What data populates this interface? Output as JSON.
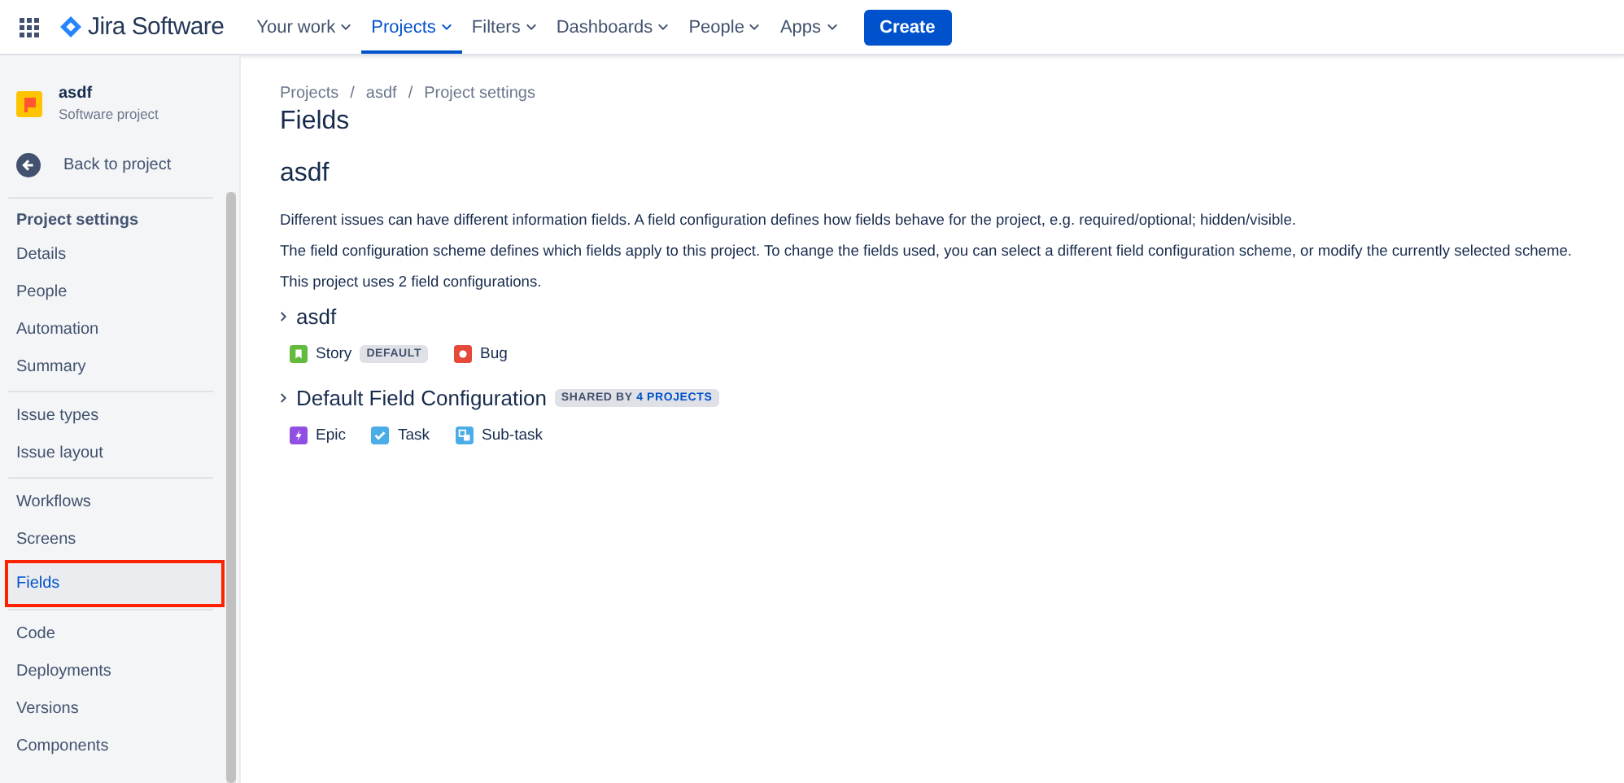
{
  "topbar": {
    "product": "Jira Software",
    "nav": [
      {
        "label": "Your work",
        "selected": false
      },
      {
        "label": "Projects",
        "selected": true
      },
      {
        "label": "Filters",
        "selected": false
      },
      {
        "label": "Dashboards",
        "selected": false
      },
      {
        "label": "People",
        "selected": false
      },
      {
        "label": "Apps",
        "selected": false
      }
    ],
    "create": "Create"
  },
  "sidebar": {
    "project": {
      "name": "asdf",
      "type": "Software project"
    },
    "back": "Back to project",
    "heading": "Project settings",
    "groups": [
      [
        {
          "label": "Details",
          "selected": false,
          "highlighted": false
        },
        {
          "label": "People",
          "selected": false,
          "highlighted": false
        },
        {
          "label": "Automation",
          "selected": false,
          "highlighted": false
        },
        {
          "label": "Summary",
          "selected": false,
          "highlighted": false
        }
      ],
      [
        {
          "label": "Issue types",
          "selected": false,
          "highlighted": false
        },
        {
          "label": "Issue layout",
          "selected": false,
          "highlighted": false
        }
      ],
      [
        {
          "label": "Workflows",
          "selected": false,
          "highlighted": false
        },
        {
          "label": "Screens",
          "selected": false,
          "highlighted": false
        },
        {
          "label": "Fields",
          "selected": true,
          "highlighted": true
        }
      ],
      [
        {
          "label": "Code",
          "selected": false,
          "highlighted": false
        },
        {
          "label": "Deployments",
          "selected": false,
          "highlighted": false
        },
        {
          "label": "Versions",
          "selected": false,
          "highlighted": false
        },
        {
          "label": "Components",
          "selected": false,
          "highlighted": false
        }
      ]
    ]
  },
  "breadcrumbs": [
    "Projects",
    "asdf",
    "Project settings"
  ],
  "breadcrumb_separator": "/",
  "title": "Fields",
  "subtitle": "asdf",
  "paragraphs": [
    "Different issues can have different information fields. A field configuration defines how fields behave for the project, e.g. required/optional; hidden/visible.",
    "The field configuration scheme defines which fields apply to this project. To change the fields used, you can select a different field configuration scheme, or modify the currently selected scheme.",
    "This project uses 2 field configurations."
  ],
  "configurations": [
    {
      "name": "asdf",
      "expanded": false,
      "issue_types": [
        {
          "name": "Story",
          "kind": "story",
          "color": "#63ba3c",
          "lozenge": "DEFAULT"
        },
        {
          "name": "Bug",
          "kind": "bug",
          "color": "#e5493a"
        }
      ]
    },
    {
      "name": "Default Field Configuration",
      "expanded": false,
      "shared": "**SHARED BY** 4 PROJECTS",
      "issue_types": [
        {
          "name": "Epic",
          "kind": "epic",
          "color": "#904ee2"
        },
        {
          "name": "Task",
          "kind": "task",
          "color": "#4bade8"
        },
        {
          "name": "Sub-task",
          "kind": "subtask",
          "color": "#4bade8"
        }
      ]
    }
  ]
}
